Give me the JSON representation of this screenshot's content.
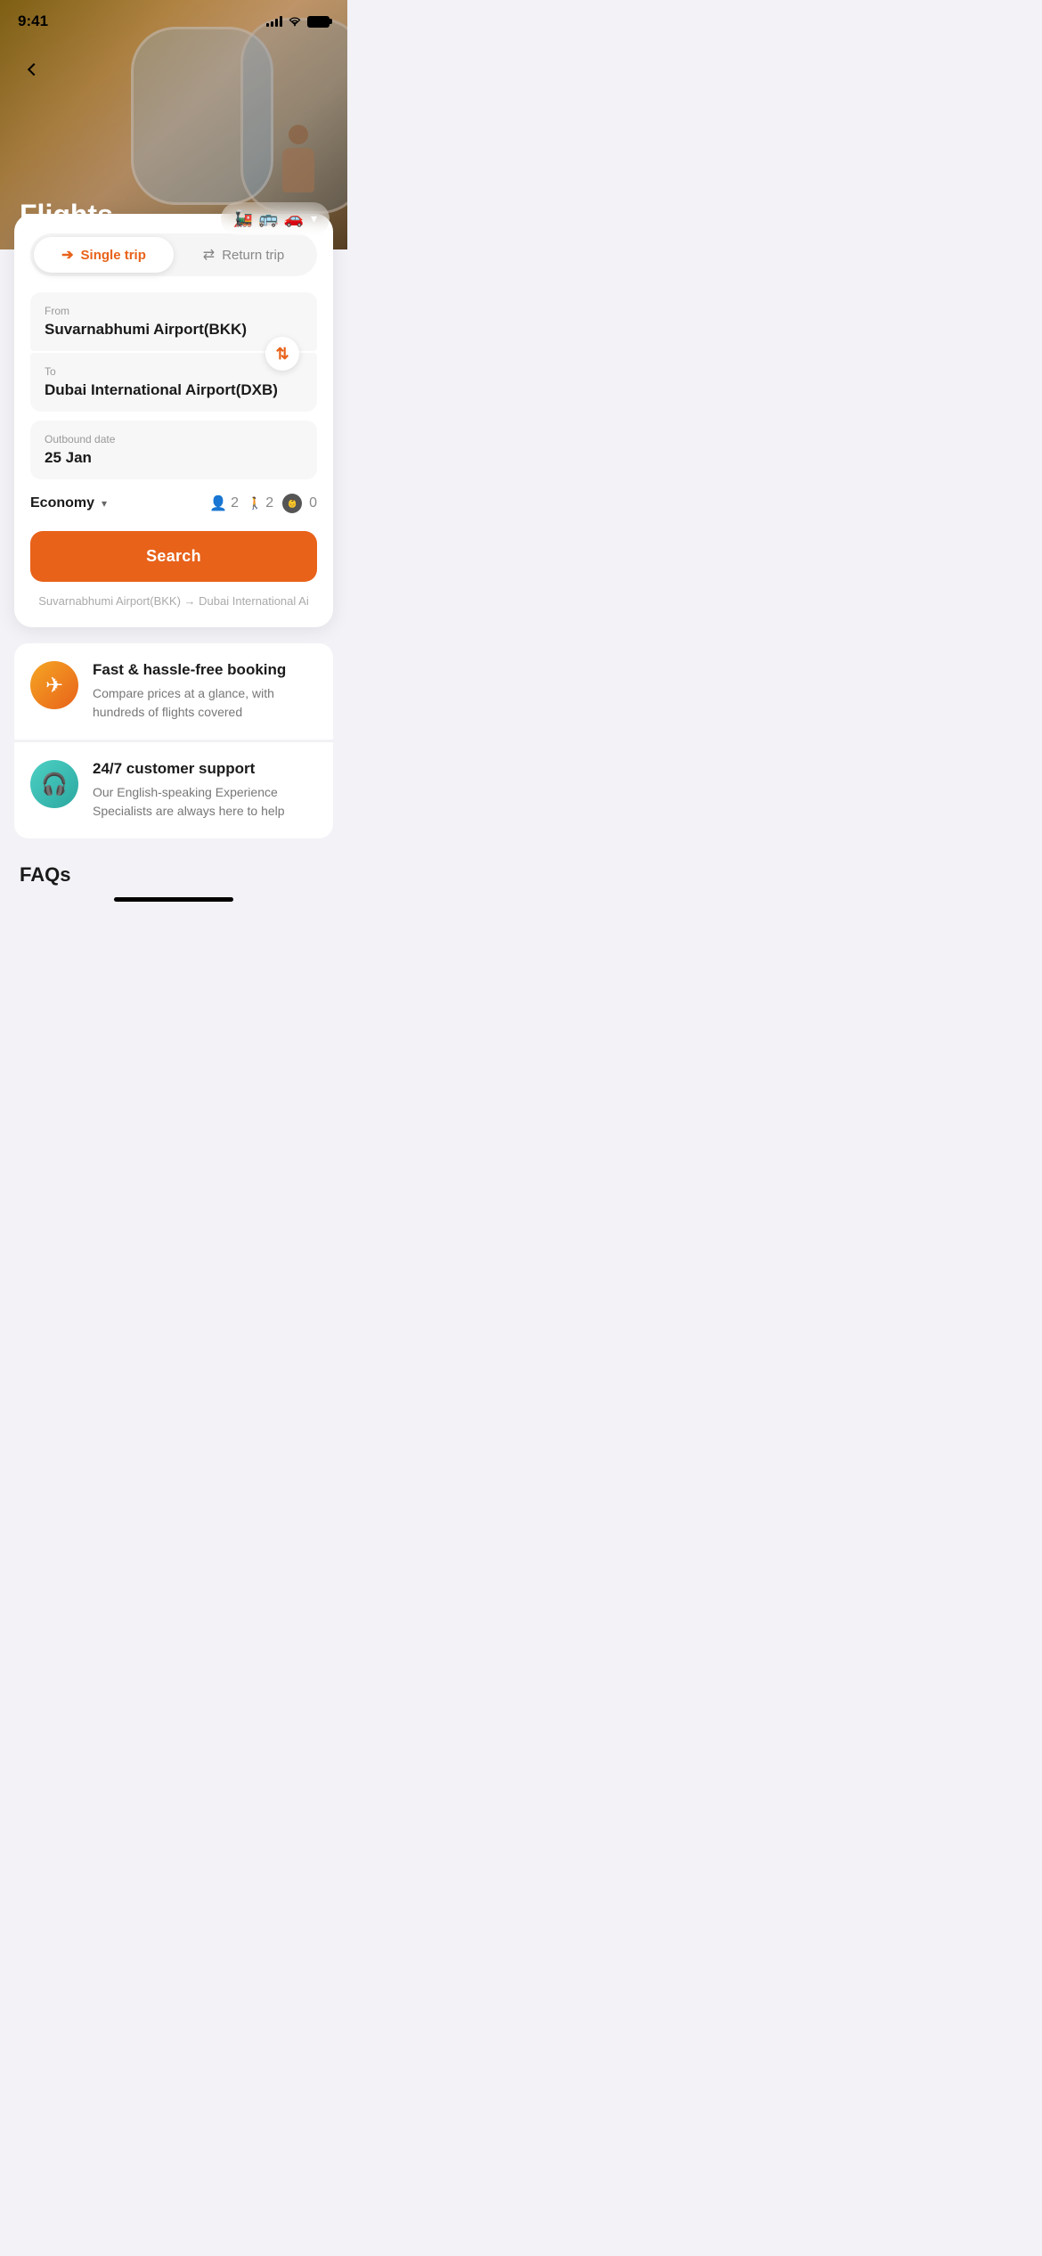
{
  "statusBar": {
    "time": "9:41"
  },
  "header": {
    "title": "Flights",
    "backLabel": "back"
  },
  "transportSelector": {
    "icons": [
      "🚂",
      "🚌",
      "🚗"
    ],
    "arrowLabel": "▾"
  },
  "tripTabs": [
    {
      "id": "single",
      "label": "Single trip",
      "icon": "→",
      "active": true
    },
    {
      "id": "return",
      "label": "Return trip",
      "icon": "⇄",
      "active": false
    }
  ],
  "fromField": {
    "label": "From",
    "value": "Suvarnabhumi Airport(BKK)"
  },
  "toField": {
    "label": "To",
    "value": "Dubai International Airport(DXB)"
  },
  "dateField": {
    "label": "Outbound date",
    "value": "25 Jan"
  },
  "classSelector": {
    "label": "Economy",
    "arrowLabel": "▾"
  },
  "passengers": {
    "adults": {
      "count": "2"
    },
    "children": {
      "count": "2"
    },
    "infants": {
      "count": "0"
    }
  },
  "searchButton": {
    "label": "Search"
  },
  "routePreview": {
    "text": "Suvarnabhumi Airport(BKK)  →  Dubai International Ai"
  },
  "features": [
    {
      "id": "booking",
      "iconType": "booking",
      "title": "Fast & hassle-free booking",
      "description": "Compare prices at a glance, with hundreds of flights covered"
    },
    {
      "id": "support",
      "iconType": "support",
      "title": "24/7 customer support",
      "description": "Our English-speaking Experience Specialists are always here to help"
    }
  ],
  "faqs": {
    "title": "FAQs"
  },
  "colors": {
    "accent": "#E8621A",
    "accentLight": "#FFF0E8"
  }
}
